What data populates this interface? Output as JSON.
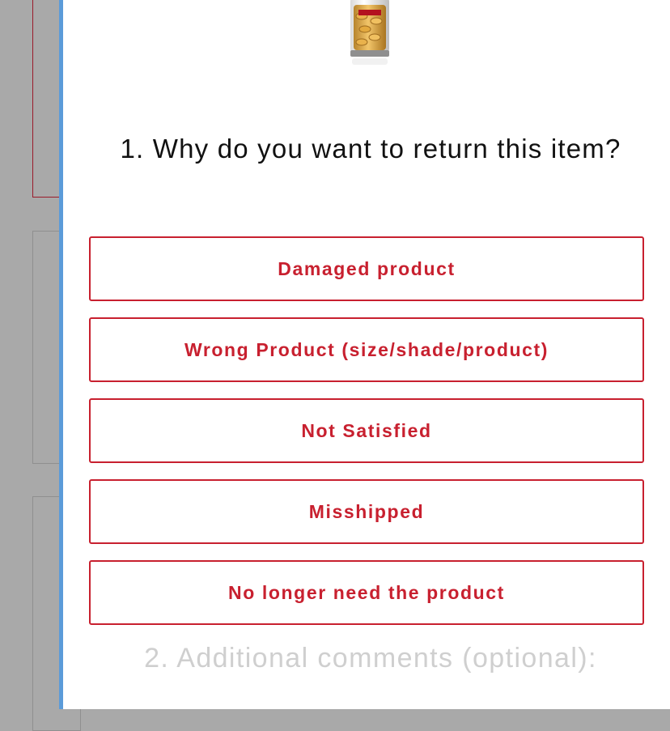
{
  "product": {
    "image_icon": "serum-capsule-jar-icon"
  },
  "question_1": {
    "title": "1. Why do you want to return this item?",
    "options": [
      {
        "label": "Damaged product"
      },
      {
        "label": "Wrong Product (size/shade/product)"
      },
      {
        "label": "Not Satisfied"
      },
      {
        "label": "Misshipped"
      },
      {
        "label": "No longer need the product"
      }
    ]
  },
  "question_2": {
    "title": "2. Additional comments (optional):"
  },
  "colors": {
    "accent_red": "#c8202f",
    "drawer_edge_blue": "#5b9bd9",
    "overlay_grey": "#a9a9a9",
    "muted_text": "#cfcfcf"
  }
}
